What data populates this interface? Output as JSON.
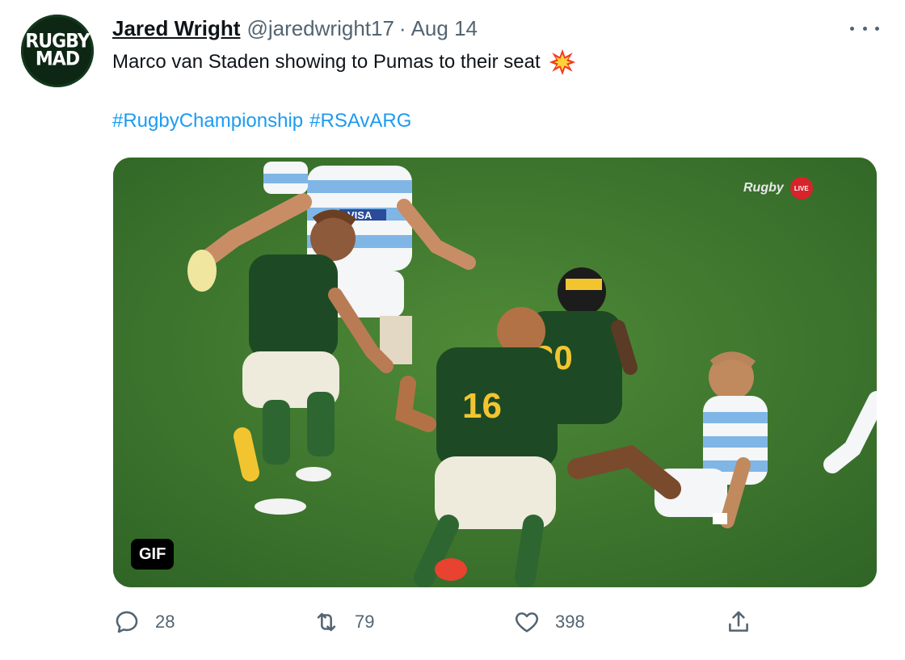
{
  "tweet": {
    "author": {
      "name": "Jared Wright",
      "handle": "@jaredwright17",
      "avatar_text_line1": "RUGBY",
      "avatar_text_line2": "MAD"
    },
    "separator": "·",
    "date": "Aug 14",
    "text": "Marco van Staden showing to Pumas to their seat",
    "emoji_icon": "collision-icon",
    "hashtags": [
      "#RugbyChampionship",
      "#RSAvARG"
    ],
    "media": {
      "badge": "GIF",
      "watermark": "Rugby",
      "watermark_live": "LIVE",
      "jersey_numbers": [
        "20",
        "16"
      ],
      "sponsor_text": "VISA"
    },
    "metrics": {
      "replies": "28",
      "retweets": "79",
      "likes": "398"
    }
  },
  "colors": {
    "link": "#1d9bf0",
    "secondary_text": "#536471",
    "pitch_green": "#3f7a2f",
    "springbok_green": "#1d4a25",
    "springbok_gold": "#f2c530",
    "pumas_blue": "#7fb6e6"
  }
}
